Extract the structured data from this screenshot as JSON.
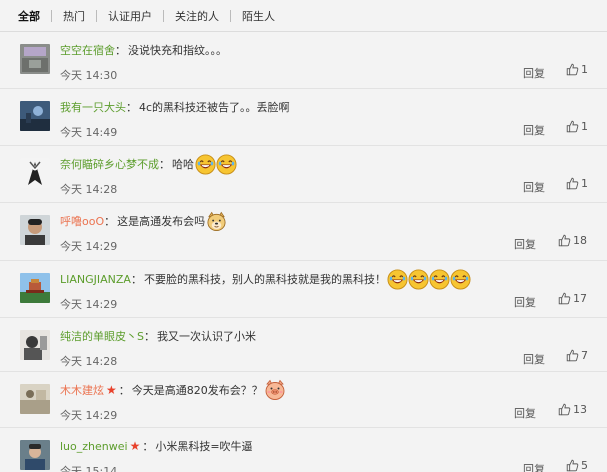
{
  "tabs": [
    "全部",
    "热门",
    "认证用户",
    "关注的人",
    "陌生人"
  ],
  "reply_label": "回复",
  "comments": [
    {
      "user": "空空在宿舍",
      "text": "没说快充和指纹。。。",
      "time": "今天 14:30",
      "likes": "1",
      "emojis": [],
      "star": false
    },
    {
      "user": "我有一只大头",
      "text": "4c的黑科技还被告了。。丢脸啊",
      "time": "今天 14:49",
      "likes": "1",
      "emojis": [],
      "star": false
    },
    {
      "user": "奈何瞄碎乡心梦不成",
      "text": "哈哈",
      "time": "今天 14:28",
      "likes": "1",
      "emojis": [
        "laughing-face",
        "laughing-face"
      ],
      "star": false
    },
    {
      "user": "呼噜ooO",
      "text": "这是高通发布会吗",
      "time": "今天 14:29",
      "likes": "18",
      "emojis": [
        "doge-face"
      ],
      "star": false
    },
    {
      "user": "LIANGJIANZA",
      "text": "不要脸的黑科技，别人的黑科技就是我的黑科技！",
      "time": "今天 14:29",
      "likes": "17",
      "emojis": [
        "laughing-face",
        "laughing-face",
        "laughing-face",
        "laughing-face"
      ],
      "star": false
    },
    {
      "user": "纯洁的单眼皮丶S",
      "text": "我又一次认识了小米",
      "time": "今天 14:28",
      "likes": "7",
      "emojis": [],
      "star": false
    },
    {
      "user": "木木建炫",
      "text": "今天是高通820发布会？？",
      "time": "今天 14:29",
      "likes": "13",
      "emojis": [
        "pig-face"
      ],
      "star": true
    },
    {
      "user": "luo_zhenwei",
      "text": "小米黑科技=吹牛逼",
      "time": "今天 15:14",
      "likes": "5",
      "emojis": [],
      "star": true
    }
  ]
}
